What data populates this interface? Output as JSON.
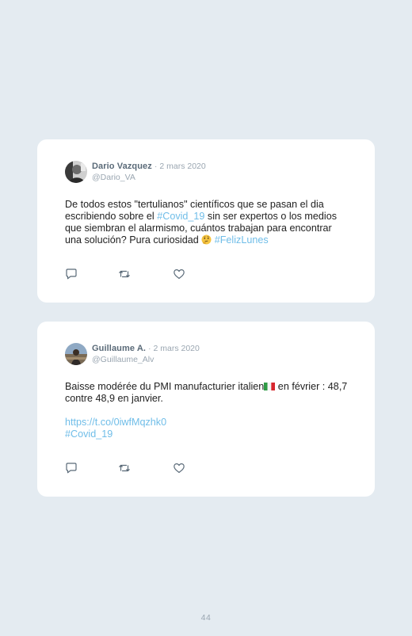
{
  "tweets": [
    {
      "author": "Dario Vazquez",
      "separator": "·",
      "date": "2 mars 2020",
      "handle": "@Dario_VA",
      "text_1": "De todos estos \"tertulianos\" científicos que se pasan el dia escribiendo sobre el ",
      "hashtag_1": "#Covid_19",
      "text_2": " sin ser expertos o los medios que siembran el alarmismo, cuántos trabajan para encontrar una solución? Pura curiosidad ",
      "emoji": "thinking-face-emoji",
      "hashtag_2": "#FelizLunes"
    },
    {
      "author": "Guillaume A.",
      "separator": "·",
      "date": "2 mars 2020",
      "handle": "@Guillaume_Alv",
      "text_1": "Baisse modérée du PMI manufacturier italien",
      "flag": "italy-flag",
      "text_2": " en février : 48,7 contre 48,9 en janvier.",
      "link": "https://t.co/0iwfMqzhk0",
      "hashtag": "#Covid_19"
    }
  ],
  "actions": [
    "reply-icon",
    "retweet-icon",
    "like-icon"
  ],
  "page_number": "44",
  "colors": {
    "background": "#e4ebf1",
    "card": "#ffffff",
    "link": "#6fbde8",
    "name": "#5a6a78",
    "muted": "#9aa6b1"
  }
}
